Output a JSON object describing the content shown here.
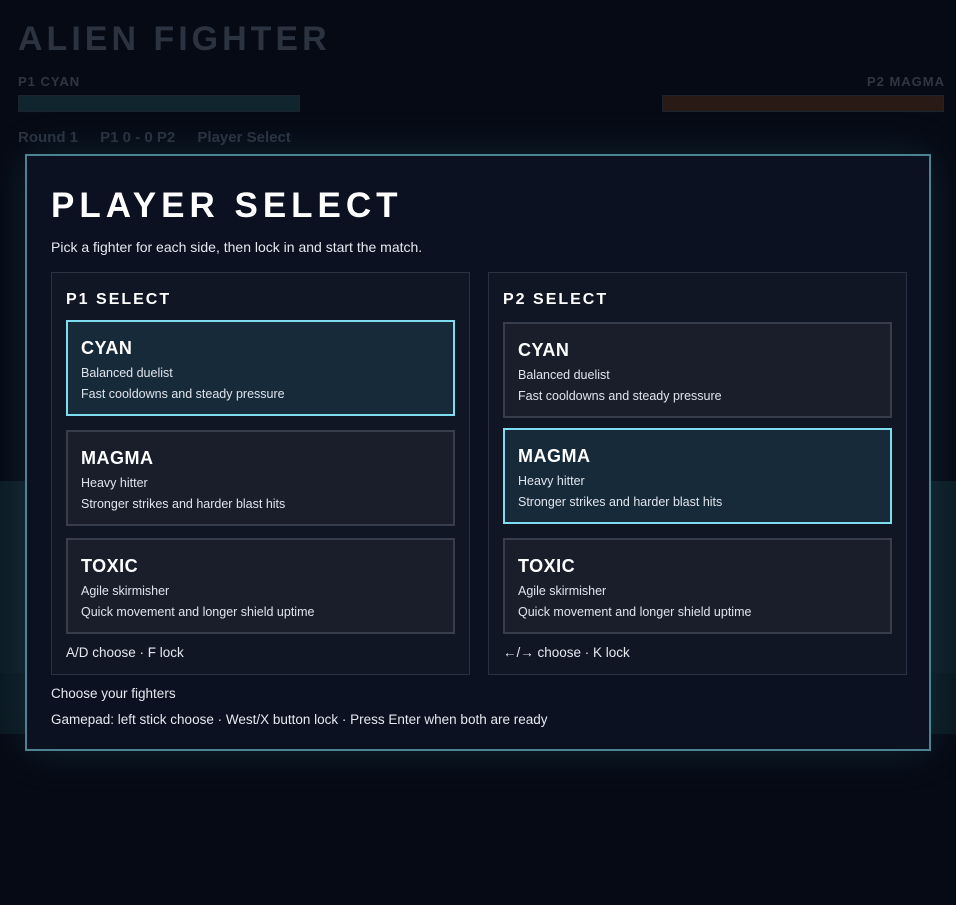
{
  "game": {
    "title": "ALIEN FIGHTER",
    "p1_label": "P1 CYAN",
    "p2_label": "P2 MAGMA",
    "p1_health": 1.0,
    "p2_health": 1.0,
    "round": "Round 1",
    "score": "P1 0 - 0 P2",
    "phase": "Player Select"
  },
  "select": {
    "title": "PLAYER SELECT",
    "subtitle": "Pick a fighter for each side, then lock in and start the match.",
    "p1": {
      "title": "P1 SELECT",
      "controls": "A/D choose · F lock",
      "selected": 0
    },
    "p2": {
      "title": "P2 SELECT",
      "controls": "←/→ choose · K lock",
      "selected": 1
    },
    "fighters": [
      {
        "name": "CYAN",
        "role": "Balanced duelist",
        "desc": "Fast cooldowns and steady pressure"
      },
      {
        "name": "MAGMA",
        "role": "Heavy hitter",
        "desc": "Stronger strikes and harder blast hits"
      },
      {
        "name": "TOXIC",
        "role": "Agile skirmisher",
        "desc": "Quick movement and longer shield uptime"
      }
    ],
    "status": "Choose your fighters",
    "gamepad": "Gamepad: left stick choose · West/X button lock · Press Enter when both are ready"
  },
  "colors": {
    "accent": "#7fdcef",
    "p1_bar": "#10252e",
    "p2_bar": "#2a1a16"
  }
}
